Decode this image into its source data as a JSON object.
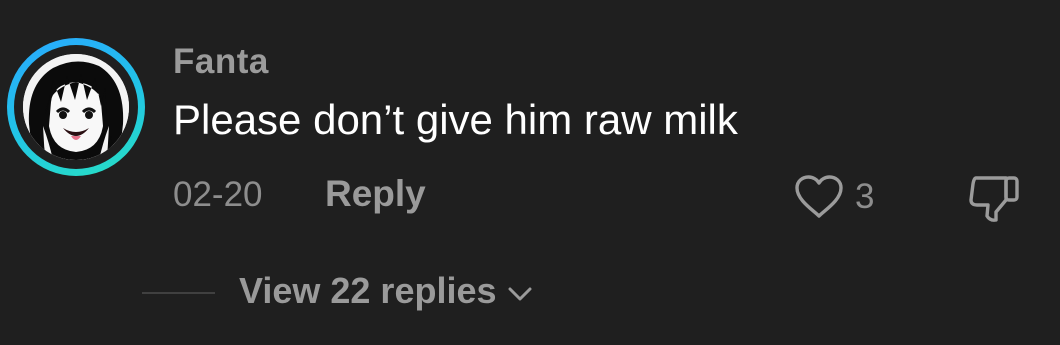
{
  "comment": {
    "username": "Fanta",
    "text": "Please don’t give him raw milk",
    "date": "02-20",
    "reply_label": "Reply",
    "like_count": "3",
    "view_replies_label": "View 22 replies"
  },
  "colors": {
    "background": "#1f1f1f",
    "avatar_ring_start": "#29a8ff",
    "avatar_ring_end": "#27e0c2",
    "text_primary": "#ffffff",
    "text_secondary": "#9b9b9b"
  },
  "icons": {
    "like": "heart-outline-icon",
    "dislike": "thumbs-down-outline-icon",
    "expand": "chevron-down-icon"
  }
}
